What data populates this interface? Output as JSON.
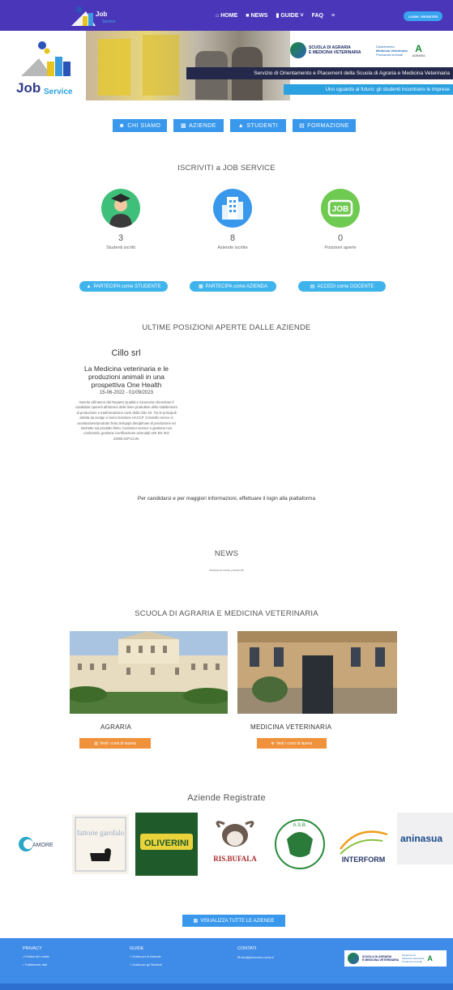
{
  "navbar": {
    "logo_text": "Job",
    "logo_sub": "Service",
    "items": [
      {
        "icon": "home-icon",
        "label": "HOME"
      },
      {
        "icon": "news-icon",
        "label": "NEWS"
      },
      {
        "icon": "book-icon",
        "label": "GUIDE"
      },
      {
        "icon": "",
        "label": "FAQ"
      }
    ],
    "menu_icon": "hamburger-icon",
    "login_label": "LOGIN / REGISTER"
  },
  "banner": {
    "logo_job": "Job",
    "logo_service": "Service",
    "agraria_line1": "SCUOLA DI AGRARIA",
    "agraria_line2": "E MEDICINA VETERINARIA",
    "vet_line1": "Dipartimento",
    "vet_line2": "Medicina Veterinaria",
    "vet_line3": "Produzioni Animali",
    "agraria_short": "AGRARIA",
    "tagline": "Servizio di Orientamento e Placement della Scuola di Agraria e Medicina Veterinaria",
    "subtagline": "Uno sguardo al futuro: gli studenti incontrano le imprese"
  },
  "tabs": [
    {
      "icon": "users-icon",
      "label": "CHI SIAMO"
    },
    {
      "icon": "building-icon",
      "label": "AZIENDE"
    },
    {
      "icon": "graduation-cap-icon",
      "label": "STUDENTI"
    },
    {
      "icon": "institution-icon",
      "label": "FORMAZIONE"
    }
  ],
  "signup": {
    "title": "ISCRIVITI a JOB SERVICE",
    "stats": [
      {
        "value": "3",
        "label": "Studenti iscritti"
      },
      {
        "value": "8",
        "label": "Aziende iscritte"
      },
      {
        "value": "0",
        "label": "Posizioni aperte"
      }
    ],
    "icon_job_text": "JOB",
    "buttons": [
      {
        "label": "PARTECIPA come STUDENTE"
      },
      {
        "label": "PARTECIPA come AZIENDA"
      },
      {
        "label": "ACCEDI come DOCENTE"
      }
    ]
  },
  "positions": {
    "title": "ULTIME POSIZIONI APERTE DALLE AZIENDE",
    "company": "Cillo srl",
    "job_title": "La Medicina veterinaria e le produzioni animali in una prospettiva One Health",
    "dates": "15-06-2022 - 01/09/2023",
    "description": "Inserito all'interno del Reparto Qualità e Sicurezza Alimentare il candidato opererà all'interno delle linee produttive dello stabilimento di produzione e trasformazione carni della Cillo srl. Tra le principali attività da svolge vi sono:Gestione HACCP ;Controllo merce in accettazione/prodotto finito;Sviluppo disciplinare di produzione ed etichette sul prodotto finito; Customer service e gestione non conformità; gestione Certificazione aziendali UNI EN ISO 22005,IGP,CCIN.",
    "login_note": "Per candidarsi e per maggiori informazioni, effettuare il login alla piattaforma"
  },
  "news": {
    "title": "NEWS",
    "empty": "Nessuna news presente"
  },
  "school": {
    "title": "SCUOLA DI AGRARIA E MEDICINA VETERINARIA",
    "cards": [
      {
        "label": "AGRARIA",
        "button": "Vedi i corsi di laurea"
      },
      {
        "label": "MEDICINA VETERINARIA",
        "button": "Vedi i corsi di laurea"
      }
    ]
  },
  "companies": {
    "title": "Aziende Registrate",
    "logos": [
      {
        "name": "AMORE"
      },
      {
        "name": "fattorie garofalo"
      },
      {
        "name": "OLIVERINI"
      },
      {
        "name": "RIS.BUFALA"
      },
      {
        "name": "A.S.B."
      },
      {
        "name": "INTERFORM"
      },
      {
        "name": "aninasua"
      }
    ],
    "view_all": "VISUALIZZA TUTTE LE AZIENDE"
  },
  "footer": {
    "col1_title": "PRIVACY",
    "col1_items": [
      "Politica dei cookie",
      "Trattamento dati"
    ],
    "col2_title": "GUIDE",
    "col2_items": [
      "Guida per le Aziende",
      "Guida per gli Studenti"
    ],
    "col3_title": "CONTATI",
    "col3_items": [
      "info@jobservice.unina.it"
    ]
  },
  "colors": {
    "nav": "#4a36b8",
    "primary": "#3a98ec",
    "cta": "#3fb4ec",
    "orange": "#f0913c",
    "footer": "#3f8be8"
  }
}
